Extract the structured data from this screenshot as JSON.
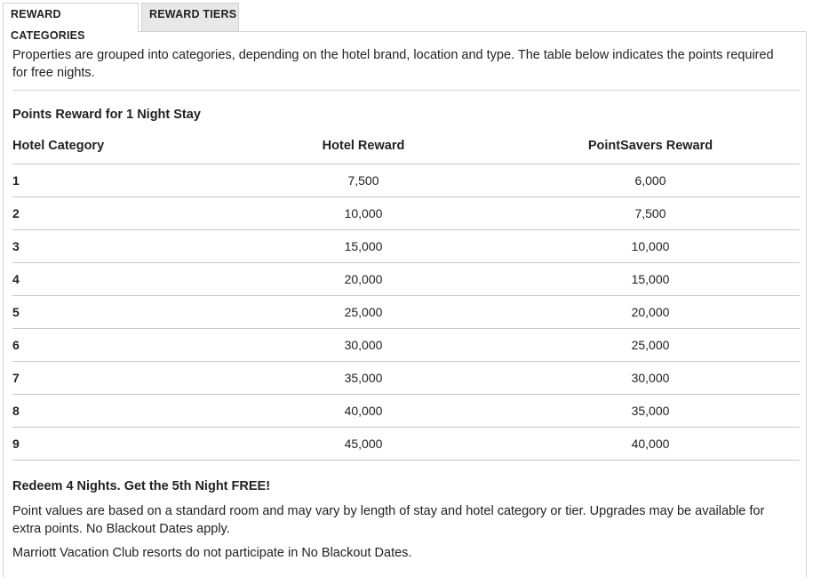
{
  "tabs": [
    {
      "label": "REWARD CATEGORIES",
      "active": true
    },
    {
      "label": "REWARD TIERS",
      "active": false
    }
  ],
  "intro": "Properties are grouped into categories, depending on the hotel brand, location and type. The table below indicates the points required for free nights.",
  "table_heading": "Points Reward for 1 Night Stay",
  "table": {
    "headers": [
      "Hotel Category",
      "Hotel Reward",
      "PointSavers Reward"
    ],
    "rows": [
      [
        "1",
        "7,500",
        "6,000"
      ],
      [
        "2",
        "10,000",
        "7,500"
      ],
      [
        "3",
        "15,000",
        "10,000"
      ],
      [
        "4",
        "20,000",
        "15,000"
      ],
      [
        "5",
        "25,000",
        "20,000"
      ],
      [
        "6",
        "30,000",
        "25,000"
      ],
      [
        "7",
        "35,000",
        "30,000"
      ],
      [
        "8",
        "40,000",
        "35,000"
      ],
      [
        "9",
        "45,000",
        "40,000"
      ]
    ]
  },
  "promo_heading": "Redeem 4 Nights. Get the 5th Night FREE!",
  "note_1": "Point values are based on a standard room and may vary by length of stay and hotel category or tier. Upgrades may be available for extra points. No Blackout Dates apply.",
  "note_2": "Marriott Vacation Club resorts do not participate in No Blackout Dates."
}
